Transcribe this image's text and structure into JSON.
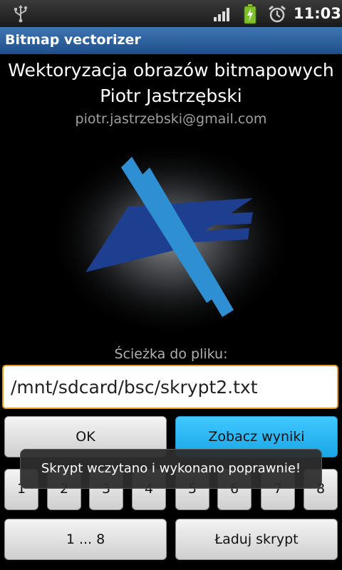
{
  "status_bar": {
    "time": "11:03",
    "icons": [
      "usb-icon",
      "signal-icon",
      "battery-charging-icon",
      "alarm-icon"
    ]
  },
  "app": {
    "title": "Bitmap vectorizer"
  },
  "header": {
    "line1": "Wektoryzacja obrazów bitmapowych",
    "line2": "Piotr Jastrzębski",
    "email": "piotr.jastrzebski@gmail.com"
  },
  "form": {
    "path_label": "Ścieżka do pliku:",
    "path_value": "/mnt/sdcard/bsc/skrypt2.txt"
  },
  "buttons": {
    "ok": "OK",
    "results": "Zobacz wyniki",
    "numbers": [
      "1",
      "2",
      "3",
      "4",
      "5",
      "6",
      "7",
      "8"
    ],
    "range": "1 ... 8",
    "load": "Ładuj skrypt"
  },
  "toast": {
    "message": "Skrypt wczytano i wykonano poprawnie!"
  },
  "colors": {
    "title_bar": "#2b5f9e",
    "accent_blue": "#29b6f6",
    "focus_orange": "#e49b1f",
    "logo_dark_blue": "#1e3f8f",
    "logo_light_blue": "#2f8fd3"
  }
}
